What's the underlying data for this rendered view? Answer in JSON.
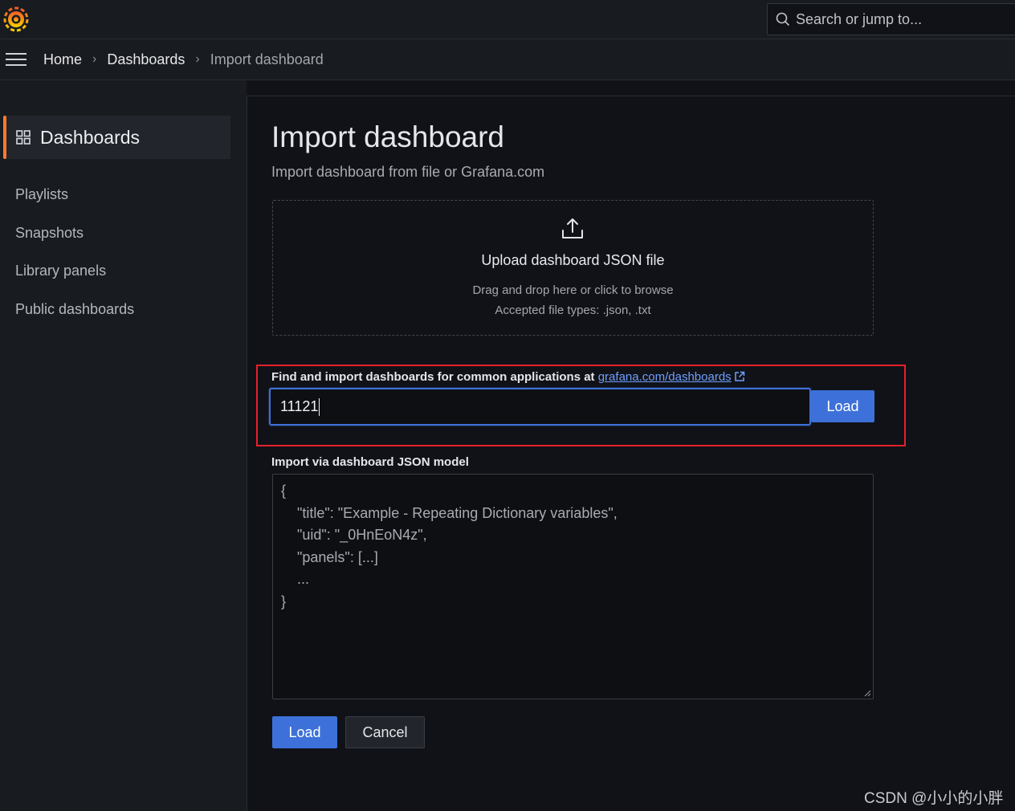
{
  "search": {
    "placeholder": "Search or jump to..."
  },
  "breadcrumb": {
    "home": "Home",
    "dashboards": "Dashboards",
    "current": "Import dashboard",
    "sep": "›"
  },
  "sidebar": {
    "header": "Dashboards",
    "items": [
      "Playlists",
      "Snapshots",
      "Library panels",
      "Public dashboards"
    ]
  },
  "main": {
    "title": "Import dashboard",
    "subtitle": "Import dashboard from file or Grafana.com",
    "upload": {
      "title": "Upload dashboard JSON file",
      "hint": "Drag and drop here or click to browse",
      "types": "Accepted file types: .json, .txt"
    },
    "gcom": {
      "label": "Find and import dashboards for common applications at",
      "link": "grafana.com/dashboards",
      "value": "11121",
      "load": "Load"
    },
    "json": {
      "label": "Import via dashboard JSON model",
      "lines": [
        "{",
        "    \"title\": \"Example - Repeating Dictionary variables\",",
        "    \"uid\": \"_0HnEoN4z\",",
        "    \"panels\": [...]",
        "    ...",
        "}"
      ]
    },
    "load_button": "Load",
    "cancel_button": "Cancel"
  },
  "watermark": "CSDN @小小的小胖",
  "colors": {
    "accent": "#ff7a2f",
    "primary": "#3d71d9",
    "highlight": "#e5212c",
    "link": "#6e9fff"
  }
}
